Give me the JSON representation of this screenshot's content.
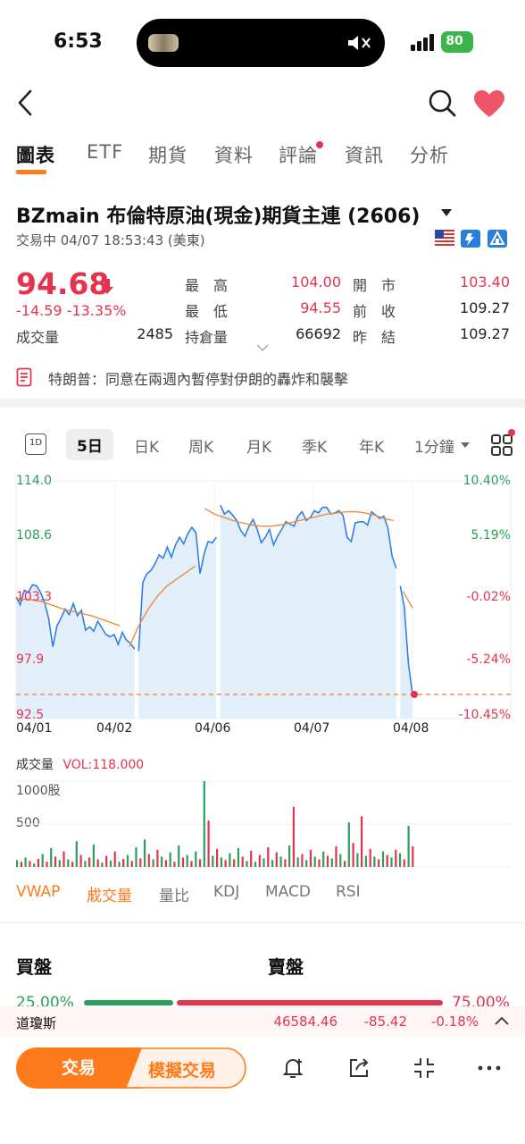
{
  "status": {
    "time": "6:53",
    "battery": "80"
  },
  "tabs": [
    "圖表",
    "ETF",
    "期貨",
    "資料",
    "評論",
    "資訊",
    "分析"
  ],
  "stock": {
    "title": "BZmain   布倫特原油(現金)期貨主連 (2606)",
    "trade_status": "交易中 04/07 18:53:43 (美東)",
    "price": "94.68",
    "change": "-14.59  -13.35%",
    "volume_label": "成交量",
    "volume_value": "2485"
  },
  "stats": [
    {
      "label": "最　高",
      "value": "104.00",
      "color": "red"
    },
    {
      "label": "開　市",
      "value": "103.40",
      "color": "red"
    },
    {
      "label": "最　低",
      "value": "94.55",
      "color": "red"
    },
    {
      "label": "前　收",
      "value": "109.27",
      "color": "dark"
    },
    {
      "label": "持倉量",
      "value": "66692",
      "color": "dark"
    },
    {
      "label": "昨　結",
      "value": "109.27",
      "color": "dark"
    }
  ],
  "news": {
    "text": "特朗普：同意在兩週內暫停對伊朗的轟炸和襲擊"
  },
  "periods": [
    "5日",
    "日K",
    "周K",
    "月K",
    "季K",
    "年K",
    "1分鐘"
  ],
  "period_1d_icon": "1D",
  "chart_data": {
    "type": "area",
    "x_ticks": [
      "04/01",
      "04/02",
      "04/06",
      "04/07",
      "04/08"
    ],
    "y_ticks": [
      "114.0",
      "108.6",
      "103.3",
      "97.9",
      "92.5"
    ],
    "pct_ticks": [
      "10.40%",
      "5.19%",
      "-0.02%",
      "-5.24%",
      "-10.45%"
    ],
    "ylim": [
      92.5,
      114.0
    ],
    "last_price": 94.68,
    "price_series": [
      103.5,
      102.8,
      104.1,
      103.9,
      104.6,
      104.5,
      103.9,
      103.0,
      101.5,
      99.0,
      100.9,
      101.6,
      102.4,
      101.9,
      102.9,
      101.8,
      102.3,
      100.5,
      100.8,
      100.4,
      101.3,
      100.7,
      100.1,
      99.9,
      100.1,
      99.2,
      100.3,
      99.6,
      99.3,
      98.8,
      98.6,
      104.8,
      105.6,
      105.9,
      106.5,
      107.3,
      107.0,
      108.0,
      107.1,
      108.2,
      108.9,
      108.3,
      109.2,
      109.8,
      109.3,
      105.6,
      107.4,
      108.5,
      108.4,
      108.9,
      111.8,
      111.0,
      111.3,
      110.9,
      110.4,
      109.5,
      109.0,
      109.9,
      110.5,
      109.6,
      108.4,
      108.9,
      109.6,
      108.2,
      109.0,
      109.6,
      110.3,
      110.1,
      109.9,
      110.8,
      111.2,
      110.4,
      110.7,
      111.3,
      111.1,
      111.6,
      111.6,
      111.0,
      111.1,
      111.3,
      110.9,
      108.9,
      108.5,
      110.2,
      110.3,
      110.3,
      110.0,
      111.2,
      110.9,
      110.6,
      110.8,
      109.7,
      107.2,
      106.1,
      104.5,
      102.6,
      97.5,
      94.68
    ],
    "ma_series": [
      103.4,
      103.3,
      103.2,
      103.0,
      102.7,
      102.4,
      102.2,
      102.0,
      101.8,
      101.5,
      101.2,
      100.9,
      99.0,
      100.9,
      102.4,
      103.6,
      104.5,
      105.1,
      105.7,
      106.3,
      111.5,
      111.0,
      110.7,
      110.4,
      110.2,
      110.0,
      109.9,
      109.9,
      110.0,
      110.2,
      110.4,
      110.6,
      110.8,
      111.0,
      111.1,
      111.2,
      111.2,
      111.1,
      110.9,
      110.6,
      110.4,
      104.0,
      102.5
    ],
    "volume": {
      "label": "成交量",
      "vol_text": "VOL:118.000",
      "y_ticks": [
        "1000股",
        "500"
      ],
      "bars": [
        [
          80,
          "g"
        ],
        [
          60,
          "r"
        ],
        [
          110,
          "g"
        ],
        [
          70,
          "r"
        ],
        [
          40,
          "g"
        ],
        [
          95,
          "r"
        ],
        [
          150,
          "g"
        ],
        [
          60,
          "r"
        ],
        [
          220,
          "g"
        ],
        [
          120,
          "r"
        ],
        [
          80,
          "g"
        ],
        [
          180,
          "r"
        ],
        [
          90,
          "g"
        ],
        [
          60,
          "r"
        ],
        [
          300,
          "g"
        ],
        [
          140,
          "r"
        ],
        [
          70,
          "g"
        ],
        [
          110,
          "r"
        ],
        [
          260,
          "g"
        ],
        [
          90,
          "r"
        ],
        [
          50,
          "g"
        ],
        [
          130,
          "r"
        ],
        [
          75,
          "g"
        ],
        [
          180,
          "r"
        ],
        [
          60,
          "g"
        ],
        [
          95,
          "r"
        ],
        [
          140,
          "g"
        ],
        [
          70,
          "r"
        ],
        [
          230,
          "g"
        ],
        [
          100,
          "r"
        ],
        [
          320,
          "g"
        ],
        [
          150,
          "r"
        ],
        [
          90,
          "g"
        ],
        [
          200,
          "r"
        ],
        [
          120,
          "g"
        ],
        [
          80,
          "r"
        ],
        [
          170,
          "g"
        ],
        [
          60,
          "r"
        ],
        [
          250,
          "g"
        ],
        [
          110,
          "r"
        ],
        [
          140,
          "g"
        ],
        [
          70,
          "r"
        ],
        [
          180,
          "g"
        ],
        [
          90,
          "r"
        ],
        [
          1000,
          "g"
        ],
        [
          540,
          "r"
        ],
        [
          130,
          "g"
        ],
        [
          210,
          "r"
        ],
        [
          110,
          "g"
        ],
        [
          80,
          "r"
        ],
        [
          160,
          "g"
        ],
        [
          90,
          "r"
        ],
        [
          220,
          "g"
        ],
        [
          120,
          "r"
        ],
        [
          70,
          "g"
        ],
        [
          190,
          "r"
        ],
        [
          60,
          "g"
        ],
        [
          140,
          "r"
        ],
        [
          100,
          "g"
        ],
        [
          230,
          "r"
        ],
        [
          80,
          "g"
        ],
        [
          170,
          "r"
        ],
        [
          120,
          "g"
        ],
        [
          90,
          "r"
        ],
        [
          250,
          "g"
        ],
        [
          700,
          "r"
        ],
        [
          110,
          "g"
        ],
        [
          150,
          "r"
        ],
        [
          80,
          "g"
        ],
        [
          200,
          "r"
        ],
        [
          120,
          "g"
        ],
        [
          90,
          "r"
        ],
        [
          180,
          "g"
        ],
        [
          130,
          "r"
        ],
        [
          100,
          "g"
        ],
        [
          240,
          "r"
        ],
        [
          150,
          "g"
        ],
        [
          70,
          "r"
        ],
        [
          520,
          "g"
        ],
        [
          280,
          "r"
        ],
        [
          160,
          "g"
        ],
        [
          590,
          "r"
        ],
        [
          130,
          "g"
        ],
        [
          210,
          "r"
        ],
        [
          120,
          "g"
        ],
        [
          90,
          "r"
        ],
        [
          180,
          "g"
        ],
        [
          140,
          "r"
        ],
        [
          110,
          "g"
        ],
        [
          200,
          "r"
        ],
        [
          160,
          "g"
        ],
        [
          90,
          "r"
        ],
        [
          480,
          "g"
        ],
        [
          240,
          "r"
        ]
      ]
    }
  },
  "indicators": [
    "VWAP",
    "成交量",
    "量比",
    "KDJ",
    "MACD",
    "RSI"
  ],
  "orderbook": {
    "bid": "買盤",
    "ask": "賣盤",
    "bid_pct": "25.00%",
    "ask_pct": "75.00%"
  },
  "index_ticker": {
    "name": "道瓊斯",
    "value": "46584.46",
    "change": "-85.42",
    "pct": "-0.18%"
  },
  "actions": {
    "trade": "交易",
    "simulate": "模擬交易"
  },
  "colors": {
    "accent": "#ff7a1a",
    "down": "#e5334f",
    "up": "#2aa05a",
    "line": "#2f80e6"
  }
}
